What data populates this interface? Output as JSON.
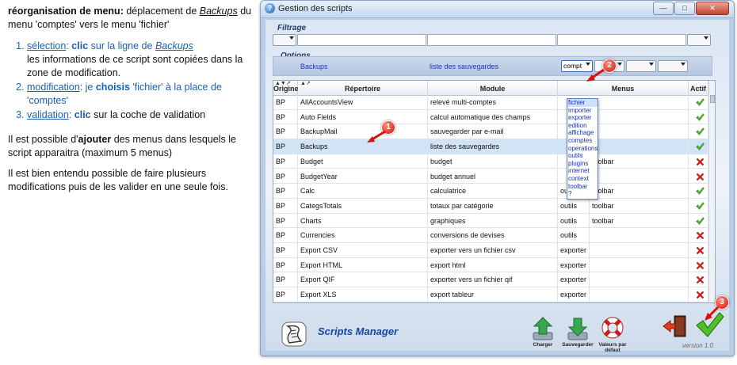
{
  "instructions": {
    "title_bold": "réorganisation de menu:",
    "title_rest_1": " déplacement de ",
    "title_italic": "Backups",
    "title_rest_2": " du menu 'comptes' vers le menu 'fichier'",
    "steps": [
      {
        "label": "sélection",
        "colon": ": ",
        "bold": "clic",
        "rest": " sur la ligne de ",
        "italic": "Backups",
        "detail": "les informations de ce script sont copiées dans la zone de modification."
      },
      {
        "label": "modification",
        "colon": ": je ",
        "bold": "choisis",
        "rest": " 'fichier' à la place de 'comptes'"
      },
      {
        "label": "validation",
        "colon": ": ",
        "bold": "clic",
        "rest": " sur la coche de validation"
      }
    ],
    "para2_pre": "Il est possible d'",
    "para2_bold": "ajouter",
    "para2_post": " des menus dans lesquels le script apparaitra (maximum 5 menus)",
    "para3": "Il est bien entendu possible de faire plusieurs modifications puis de les valider en une seule fois."
  },
  "window": {
    "title": "Gestion des scripts",
    "app_icon": "script-app-icon",
    "filter_title": "Filtrage",
    "options_title": "Options",
    "options_repertoire": "Backups",
    "options_module": "liste des sauvegardes",
    "options_menu_value": "compt",
    "columns": {
      "origine": "Origine",
      "repertoire": "Répertoire",
      "module": "Module",
      "menus": "Menus",
      "actif": "Actif"
    },
    "rows": [
      {
        "origine": "BP",
        "repertoire": "AllAccountsView",
        "module": "relevé multi-comptes",
        "menu1": "",
        "menu2": "",
        "actif": true
      },
      {
        "origine": "BP",
        "repertoire": "Auto Fields",
        "module": "calcul automatique des champs",
        "menu1": "",
        "menu2": "",
        "actif": true
      },
      {
        "origine": "BP",
        "repertoire": "BackupMail",
        "module": "sauvegarder par e-mail",
        "menu1": "",
        "menu2": "",
        "actif": true
      },
      {
        "origine": "BP",
        "repertoire": "Backups",
        "module": "liste des sauvegardes",
        "menu1": "",
        "menu2": "",
        "actif": true
      },
      {
        "origine": "BP",
        "repertoire": "Budget",
        "module": "budget",
        "menu1": "",
        "menu2": "toolbar",
        "actif": false
      },
      {
        "origine": "BP",
        "repertoire": "BudgetYear",
        "module": "budget annuel",
        "menu1": "",
        "menu2": "",
        "actif": false
      },
      {
        "origine": "BP",
        "repertoire": "Calc",
        "module": "calculatrice",
        "menu1": "outils",
        "menu2": "toolbar",
        "actif": true
      },
      {
        "origine": "BP",
        "repertoire": "CategsTotals",
        "module": "totaux par catégorie",
        "menu1": "outils",
        "menu2": "toolbar",
        "actif": true
      },
      {
        "origine": "BP",
        "repertoire": "Charts",
        "module": "graphiques",
        "menu1": "outils",
        "menu2": "toolbar",
        "actif": true
      },
      {
        "origine": "BP",
        "repertoire": "Currencies",
        "module": "conversions de devises",
        "menu1": "outils",
        "menu2": "",
        "actif": false
      },
      {
        "origine": "BP",
        "repertoire": "Export CSV",
        "module": "exporter vers un fichier csv",
        "menu1": "exporter",
        "menu2": "",
        "actif": false
      },
      {
        "origine": "BP",
        "repertoire": "Export HTML",
        "module": "export html",
        "menu1": "exporter",
        "menu2": "",
        "actif": false
      },
      {
        "origine": "BP",
        "repertoire": "Export QIF",
        "module": "exporter vers un fichier qif",
        "menu1": "exporter",
        "menu2": "",
        "actif": false
      },
      {
        "origine": "BP",
        "repertoire": "Export XLS",
        "module": "export tableur",
        "menu1": "exporter",
        "menu2": "",
        "actif": false
      }
    ],
    "menu_options": [
      "fichier",
      "importer",
      "exporter",
      "edition",
      "affichage",
      "comptes",
      "operations",
      "outils",
      "plugins",
      "internet",
      "context",
      "toolbar",
      "?"
    ],
    "app_name": "Scripts Manager",
    "buttons": {
      "charger": "Charger",
      "sauvegarder": "Sauvegarder",
      "defaut": "Valeurs par défaut"
    },
    "version": "version 1.0",
    "callouts": [
      "1",
      "2",
      "3"
    ],
    "colors": {
      "active_check": "#4caf2a",
      "inactive_cross": "#d61a1a",
      "callout": "#d4140c",
      "link_blue": "#1b5fb3"
    }
  }
}
